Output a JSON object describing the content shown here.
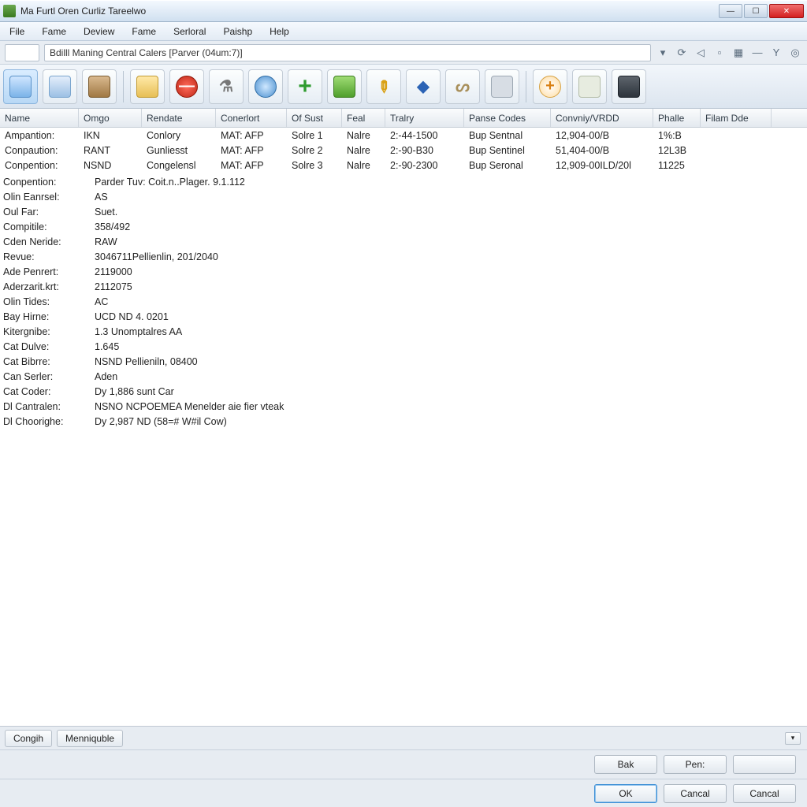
{
  "title": "Ma Furtl Oren Curliz Tareelwo",
  "menu": [
    "File",
    "Fame",
    "Deview",
    "Fame",
    "Serloral",
    "Paishp",
    "Help"
  ],
  "address": {
    "value": "Bdilll Maning Central Calers [Parver (04um:7)]"
  },
  "addr_tools": [
    "dropdown",
    "refresh",
    "back",
    "stop",
    "grid",
    "line",
    "filter",
    "target"
  ],
  "toolbar_names": [
    "doc",
    "docalt",
    "box",
    "folder",
    "stop",
    "flask",
    "globe",
    "plus",
    "bag",
    "pencil",
    "pin",
    "lasso",
    "rect",
    "addcircle",
    "page",
    "save"
  ],
  "columns": [
    "Name",
    "Omgo",
    "Rendate",
    "Conerlort",
    "Of Sust",
    "Feal",
    "Tralry",
    "Panse Codes",
    "Convniy/VRDD",
    "Phalle",
    "Filam Dde"
  ],
  "rows": [
    {
      "c": [
        "Ampantion:",
        "IKN",
        "Conlory",
        "MAT: AFP",
        "Solre 1",
        "Nalre",
        "2:-44-1500",
        "Bup Sentnal",
        "12,904-00/B",
        "1%:B",
        ""
      ]
    },
    {
      "c": [
        "Conpaution:",
        "RANT",
        "Gunliesst",
        "MAT: AFP",
        "Solre 2",
        "Nalre",
        "2:-90-B30",
        "Bup Sentinel",
        "51,404-00/B",
        "12L3B",
        ""
      ]
    },
    {
      "c": [
        "Conpention:",
        "NSND",
        "Congelensl",
        "MAT: AFP",
        "Solre 3",
        "Nalre",
        "2:-90-2300",
        "Bup Seronal",
        "12,909-00ILD/20l",
        "11225",
        ""
      ]
    }
  ],
  "props": [
    {
      "k": "Conpention:",
      "v": "Parder Tuv: Coit.n..Plager. 9.1.112"
    },
    {
      "k": "Olin Eanrsel:",
      "v": "AS"
    },
    {
      "k": "Oul Far:",
      "v": "Suet."
    },
    {
      "k": "Compitile:",
      "v": "358/492"
    },
    {
      "k": "Cden Neride:",
      "v": "RAW"
    },
    {
      "k": "Revue:",
      "v": "3046711Pellienlin, 201/2040"
    },
    {
      "k": "Ade Penrert:",
      "v": "2119000"
    },
    {
      "k": "Aderzarit.krt:",
      "v": "2112075"
    },
    {
      "k": "Olin Tides:",
      "v": "AC"
    },
    {
      "k": "Bay Hirne:",
      "v": "UCD ND 4. 0201"
    },
    {
      "k": "Kitergnibe:",
      "v": "1.3 Unomptalres AA"
    },
    {
      "k": "Cat Dulve:",
      "v": "1.645"
    },
    {
      "k": "Cat Bibrre:",
      "v": "NSND Pellieniln, 08400"
    },
    {
      "k": "Can Serler:",
      "v": "Aden"
    },
    {
      "k": "Cat Coder:",
      "v": "Dy 1,886 sunt Car"
    },
    {
      "k": "Dl Cantralen:",
      "v": "NSNO NCPOEMEA Menelder aie fier vteak"
    },
    {
      "k": "Dl Choorighe:",
      "v": "Dy 2,987 ND (58=# W#il Cow)"
    }
  ],
  "bottom_tabs": [
    "Congih",
    "Menniquble"
  ],
  "buttons_row1": [
    "Bak",
    "Pen:",
    ""
  ],
  "buttons_row2": [
    "OK",
    "Cancal",
    "Cancal"
  ]
}
